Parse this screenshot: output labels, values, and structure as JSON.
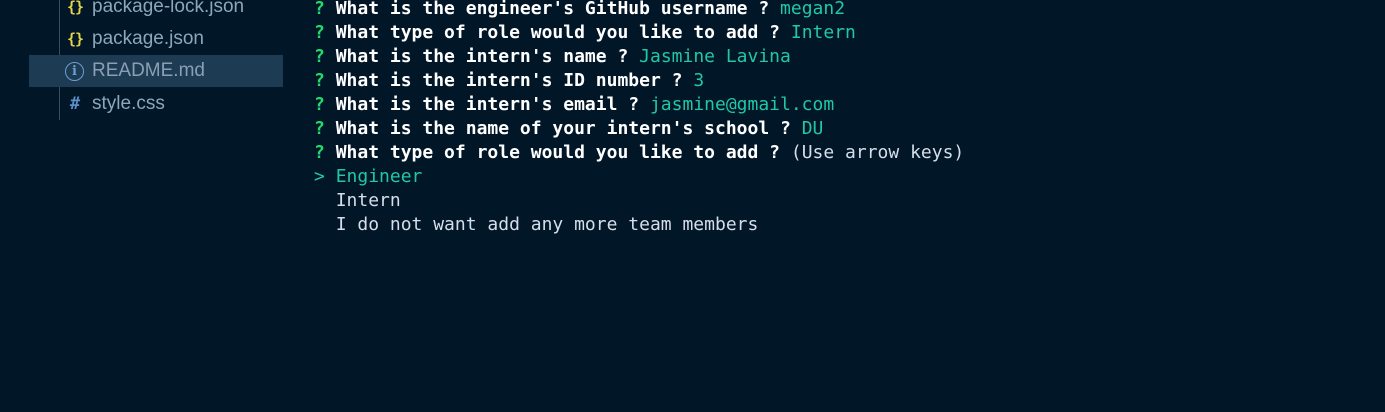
{
  "sidebar": {
    "files": [
      {
        "name": "package-lock.json",
        "icon": "{}"
      },
      {
        "name": "package.json",
        "icon": "{}"
      },
      {
        "name": "README.md",
        "icon": "i"
      },
      {
        "name": "style.css",
        "icon": "#"
      }
    ]
  },
  "terminal": {
    "prompt_mark": "?",
    "questions": [
      {
        "text": "What is the engineer's GitHub username ?",
        "answer": "megan2"
      },
      {
        "text": "What type of role would you like to add ?",
        "answer": "Intern"
      },
      {
        "text": "What is the intern's name ?",
        "answer": "Jasmine Lavina"
      },
      {
        "text": "What is the intern's ID number ?",
        "answer": "3"
      },
      {
        "text": "What is the intern's email ?",
        "answer": "jasmine@gmail.com"
      },
      {
        "text": "What is the name of your intern's school ?",
        "answer": "DU"
      },
      {
        "text": "What type of role would you like to add ?",
        "hint": "(Use arrow keys)"
      }
    ],
    "pointer": ">",
    "choices": [
      "Engineer",
      "Intern",
      "I do not want add any more team members"
    ]
  }
}
